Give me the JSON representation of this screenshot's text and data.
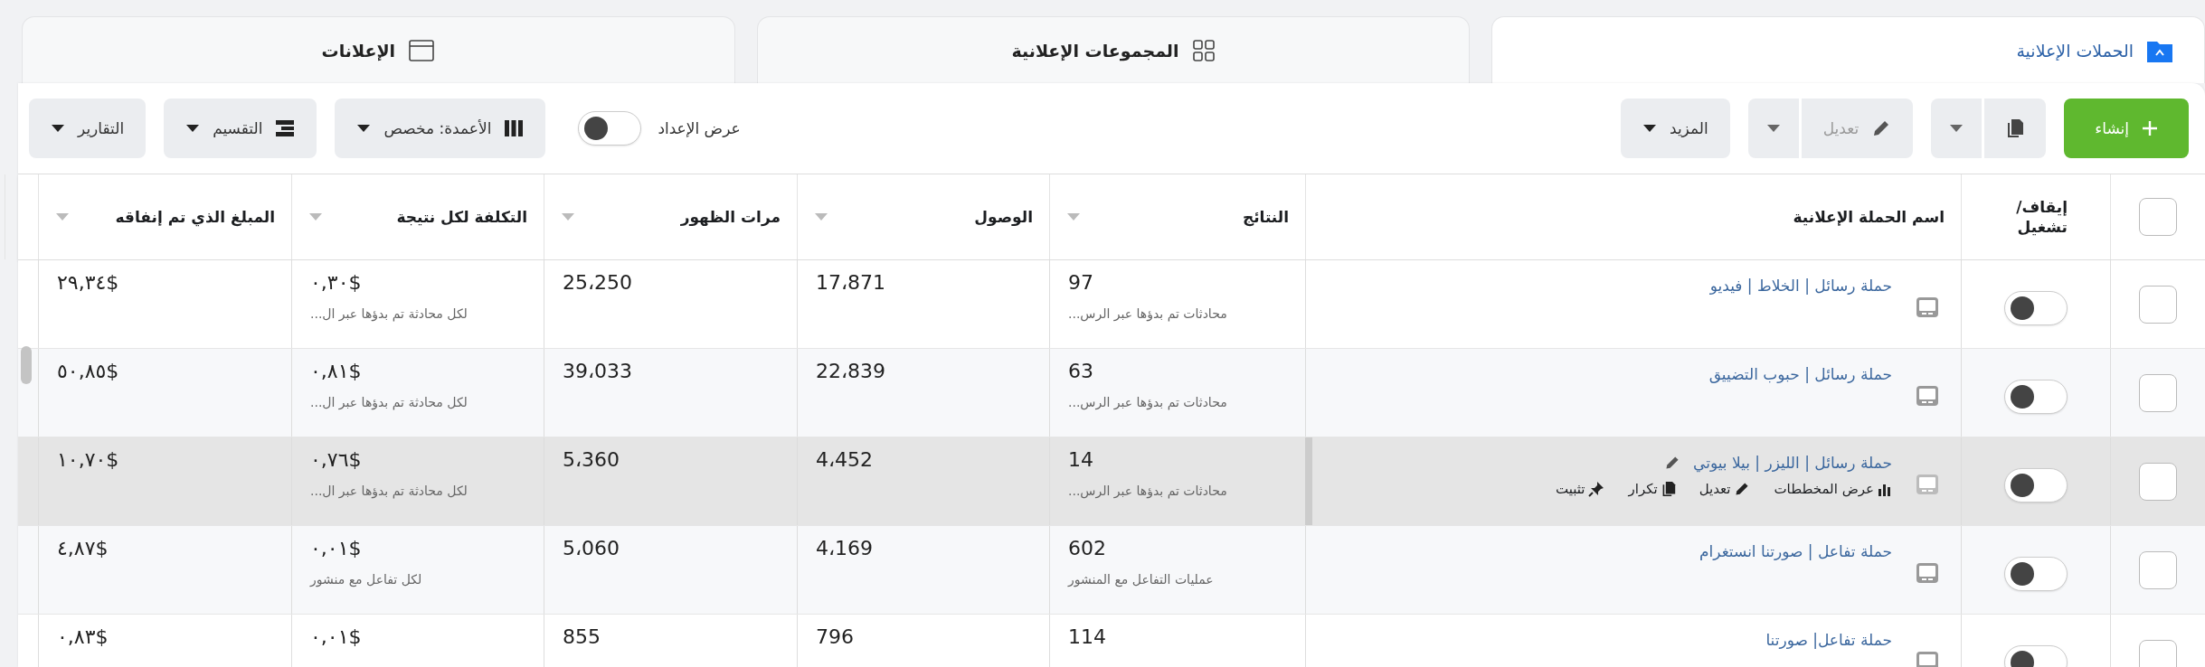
{
  "tabs": [
    {
      "label": "الحملات الإعلانية",
      "selected": true
    },
    {
      "label": "المجموعات الإعلانية",
      "selected": false
    },
    {
      "label": "الإعلانات",
      "selected": false
    }
  ],
  "toolbar": {
    "create": "إنشاء",
    "edit": {
      "label": "تعديل",
      "disabled": true
    },
    "more": "المزيد",
    "preview": {
      "label": "عرض الإعداد",
      "on": false
    },
    "columns": "الأعمدة: مخصص",
    "breakdown": "التقسيم",
    "reports": "التقارير"
  },
  "table": {
    "all_selected": false,
    "columns": [
      {
        "label": "إيقاف/ تشغيل",
        "sortable": false
      },
      {
        "label": "اسم الحملة الإعلانية",
        "sortable": false
      },
      {
        "label": "النتائج",
        "sortable": true
      },
      {
        "label": "الوصول",
        "sortable": true
      },
      {
        "label": "مرات الظهور",
        "sortable": true
      },
      {
        "label": "التكلفة لكل نتيجة",
        "sortable": true
      },
      {
        "label": "المبلغ الذي تم إنفاقه",
        "sortable": true
      }
    ],
    "rows": [
      {
        "selected": false,
        "on": false,
        "hovered": false,
        "name": "حملة رسائل | الخلاط | فيديو",
        "results": "97",
        "results_label": "محادثات تم بدؤها عبر الرس...",
        "reach": "17،871",
        "impressions": "25،250",
        "cost": "٠,٣٠$",
        "cost_label": "لكل محادثة تم بدؤها عبر ال...",
        "spent": "٢٩,٣٤$"
      },
      {
        "selected": false,
        "on": false,
        "hovered": false,
        "name": "حملة رسائل | حبوب التضييق",
        "results": "63",
        "results_label": "محادثات تم بدؤها عبر الرس...",
        "reach": "22،839",
        "impressions": "39،033",
        "cost": "٠,٨١$",
        "cost_label": "لكل محادثة تم بدؤها عبر ال...",
        "spent": "٥٠,٨٥$"
      },
      {
        "selected": false,
        "on": false,
        "hovered": true,
        "name": "حملة رسائل | الليزر | بيلا بيوتي",
        "results": "14",
        "results_label": "محادثات تم بدؤها عبر الرس...",
        "reach": "4،452",
        "impressions": "5،360",
        "cost": "٠,٧٦$",
        "cost_label": "لكل محادثة تم بدؤها عبر ال...",
        "spent": "١٠,٧٠$",
        "actions": [
          {
            "kind": "chart",
            "label": "عرض المخططات"
          },
          {
            "kind": "edit",
            "label": "تعديل"
          },
          {
            "kind": "copy",
            "label": "تكرار"
          },
          {
            "kind": "pin",
            "label": "تثبيت"
          }
        ]
      },
      {
        "selected": false,
        "on": false,
        "hovered": false,
        "name": "حملة تفاعل | صورتنا انستغرام",
        "results": "602",
        "results_label": "عمليات التفاعل مع المنشور",
        "reach": "4،169",
        "impressions": "5،060",
        "cost": "٠,٠١$",
        "cost_label": "لكل تفاعل مع منشور",
        "spent": "٤,٨٧$"
      },
      {
        "selected": false,
        "on": false,
        "hovered": false,
        "name": "حملة تفاعل| صورتنا",
        "results": "114",
        "reach": "796",
        "impressions": "855",
        "cost": "٠,٠١$",
        "spent": "٠,٨٣$"
      }
    ]
  }
}
